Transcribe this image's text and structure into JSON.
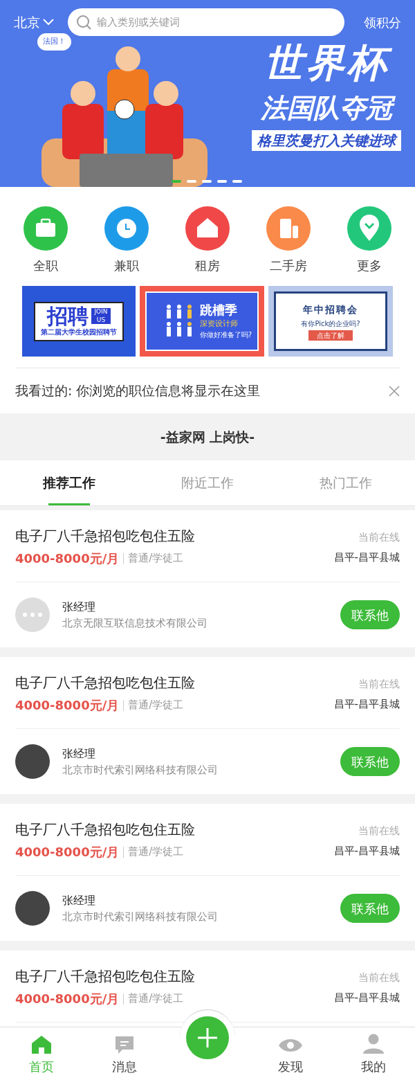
{
  "header": {
    "city": "北京",
    "search_placeholder": "输入类别或关键词",
    "points_link": "领积分"
  },
  "banner": {
    "bubble": "法国！",
    "headline": "世界杯",
    "subhead": "法国队夺冠",
    "tagline": "格里茨曼打入关键进球",
    "dots": [
      {
        "selected": true
      },
      {
        "selected": false
      },
      {
        "selected": false
      },
      {
        "selected": false
      },
      {
        "selected": false
      }
    ]
  },
  "categories": [
    {
      "label": "全职",
      "kind": "briefcase"
    },
    {
      "label": "兼职",
      "kind": "clock"
    },
    {
      "label": "租房",
      "kind": "house"
    },
    {
      "label": "二手房",
      "kind": "phone"
    },
    {
      "label": "更多",
      "kind": "pin"
    }
  ],
  "promos": [
    {
      "kind": "recruit",
      "title": "招聘",
      "badge": "JOIN US",
      "caption": "第二届大学生校园招聘节"
    },
    {
      "kind": "jobhop",
      "title": "跳槽季",
      "subtitle": "深资设计师",
      "caption": "你做好准备了吗?"
    },
    {
      "kind": "fair",
      "title": "年中招聘会",
      "subtitle": "有你Pick的企业吗?",
      "caption": "点击了解"
    }
  ],
  "history": {
    "text": "我看过的: 你浏览的职位信息将显示在这里"
  },
  "slogan": "-益家网 上岗快-",
  "tabs": [
    {
      "label": "推荐工作",
      "selected": true
    },
    {
      "label": "附近工作",
      "selected": false
    },
    {
      "label": "热门工作",
      "selected": false
    }
  ],
  "jobs": [
    {
      "title": "电子厂八千急招包吃包住五险",
      "salary": "4000-8000元/月",
      "type": "普通/学徒工",
      "status": "当前在线",
      "location": "昌平-昌平县城",
      "contact": "张经理",
      "company": "北京无限互联信息技术有限公司",
      "avatar": {
        "kind": "default"
      },
      "button": "联系他"
    },
    {
      "title": "电子厂八千急招包吃包住五险",
      "salary": "4000-8000元/月",
      "type": "普通/学徒工",
      "status": "当前在线",
      "location": "昌平-昌平县城",
      "contact": "张经理",
      "company": "北京市时代索引网络科技有限公司",
      "avatar": {
        "kind": "photo"
      },
      "button": "联系他"
    },
    {
      "title": "电子厂八千急招包吃包住五险",
      "salary": "4000-8000元/月",
      "type": "普通/学徒工",
      "status": "当前在线",
      "location": "昌平-昌平县城",
      "contact": "张经理",
      "company": "北京市时代索引网络科技有限公司",
      "avatar": {
        "kind": "photo"
      },
      "button": "联系他"
    },
    {
      "title": "电子厂八千急招包吃包住五险",
      "salary": "4000-8000元/月",
      "type": "普通/学徒工",
      "status": "当前在线",
      "location": "昌平-昌平县城"
    }
  ],
  "nav": [
    {
      "label": "首页",
      "kind": "home",
      "selected": true
    },
    {
      "label": "消息",
      "kind": "message",
      "selected": false
    },
    {
      "kind": "add",
      "selected": false
    },
    {
      "label": "发现",
      "kind": "eye",
      "selected": false
    },
    {
      "label": "我的",
      "kind": "user",
      "selected": false
    }
  ]
}
